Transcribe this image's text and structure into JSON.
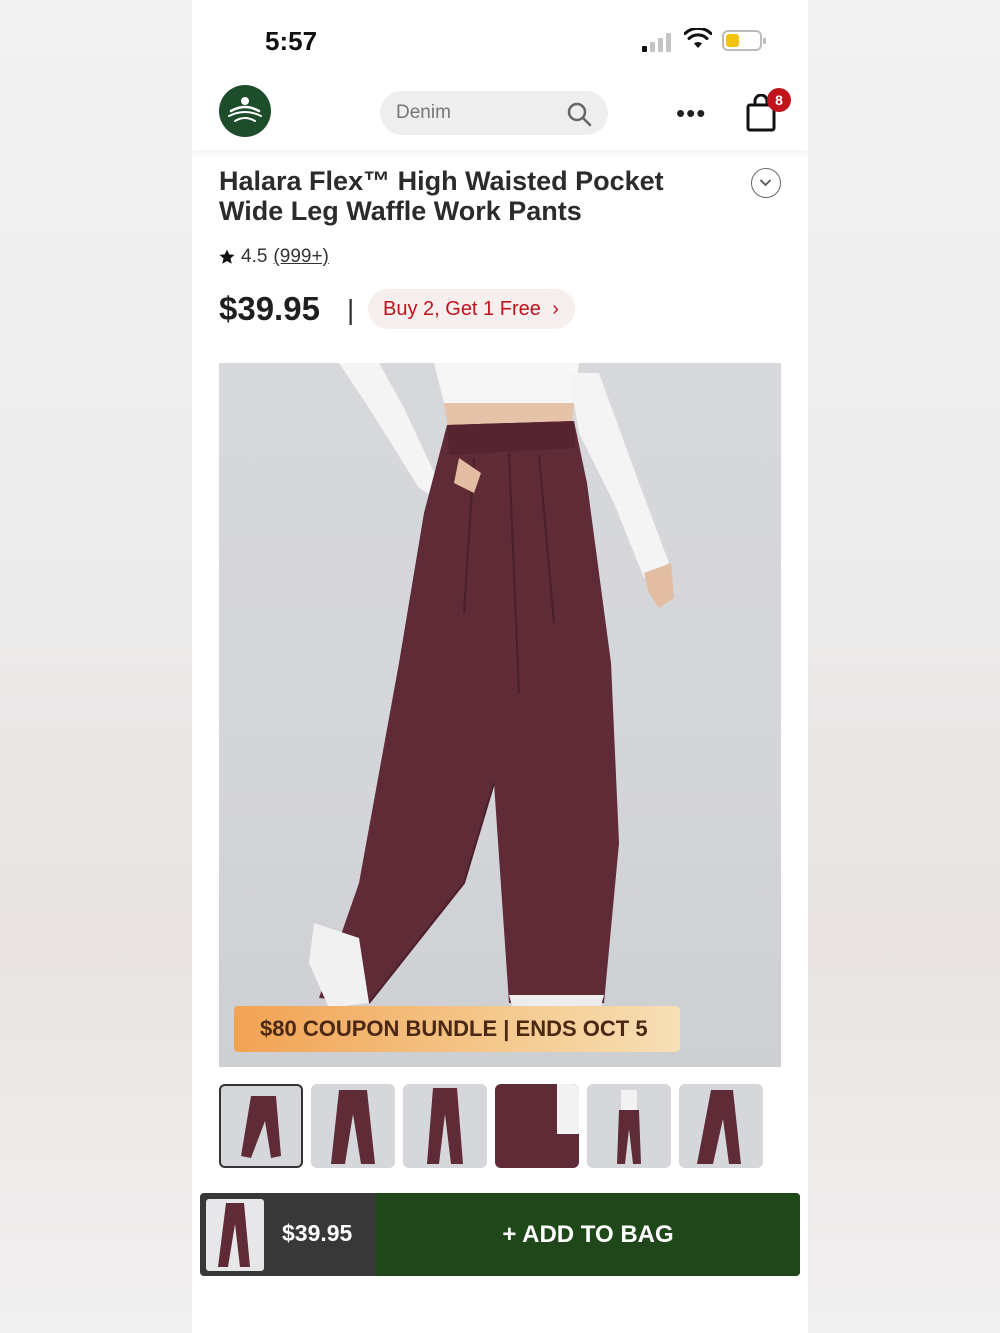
{
  "status_bar": {
    "time": "5:57"
  },
  "header": {
    "search_placeholder": "Denim",
    "cart_count": "8"
  },
  "product": {
    "title": "Halara Flex™ High Waisted Pocket Wide Leg Waffle Work Pants",
    "rating": "4.5",
    "review_count": "(999+)",
    "price": "$39.95",
    "separator": "|",
    "promo_label": "Buy 2, Get 1 Free",
    "coupon_banner": "$80 COUPON BUNDLE | ENDS OCT 5",
    "pants_color": "#5e2b36"
  },
  "thumbnails": [
    "front-view",
    "side-view",
    "back-view",
    "waist-detail",
    "full-body",
    "front-alt"
  ],
  "bottom_bar": {
    "price": "$39.95",
    "add_label": "ADD TO BAG"
  },
  "colors": {
    "brand_green": "#1e4d2b",
    "add_button": "#1f4719",
    "promo_red": "#c0131c"
  }
}
